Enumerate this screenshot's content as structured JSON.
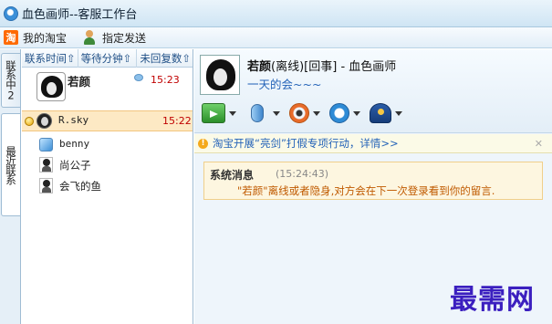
{
  "window": {
    "title": "血色画师--客服工作台"
  },
  "toolbar": {
    "my_taobao": "我的淘宝",
    "assign_send": "指定发送",
    "taobao_icon_text": "淘"
  },
  "side_tabs": {
    "contacting": "联系中2",
    "recent": "最近联系"
  },
  "list": {
    "columns": [
      "联系时间⇧",
      "等待分钟⇧",
      "未回复数⇧"
    ],
    "rows": [
      {
        "name": "若颜",
        "time": "15:23",
        "icon": "avatar-girl",
        "unread_icon": "message-bubble-icon"
      },
      {
        "name": "R.sky",
        "time": "15:22",
        "icon": "avatar-dark",
        "selected": true,
        "status_icon": "away-status-icon"
      },
      {
        "name": "benny",
        "time": "",
        "icon": "avatar-blue"
      },
      {
        "name": "尚公子",
        "time": "",
        "icon": "avatar-person"
      },
      {
        "name": "会飞的鱼",
        "time": "",
        "icon": "avatar-person"
      }
    ]
  },
  "chat": {
    "name": "若颜",
    "status": "(离线)[回事]",
    "sep": " - ",
    "shop": "血色画师",
    "signature": "一天的会~~~",
    "tools": [
      "file-transfer-icon",
      "voice-mic-icon",
      "video-camera-icon",
      "remote-screen-icon",
      "report-police-icon"
    ],
    "notice": "淘宝开展“亮剑”打假专项行动，详情>>",
    "notice_close": "✕",
    "system_label": "系统消息",
    "system_time": "(15:24:43)",
    "system_text": "\"若颜\"离线或者隐身,对方会在下一次登录看到你的留言."
  },
  "watermark": "最需网"
}
